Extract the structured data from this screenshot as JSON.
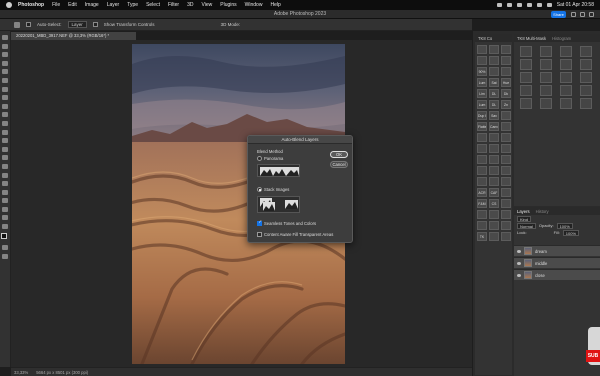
{
  "menubar": {
    "app": "Photoshop",
    "items": [
      "File",
      "Edit",
      "Image",
      "Layer",
      "Type",
      "Select",
      "Filter",
      "3D",
      "View",
      "Plugins",
      "Window",
      "Help"
    ],
    "clock": "Sat 01 Apr  20:58"
  },
  "window": {
    "title": "Adobe Photoshop 2023",
    "share_label": "Share"
  },
  "options": {
    "auto_select": "Auto-Select:",
    "target": "Layer",
    "show_transform": "Show Transform Controls",
    "mode_3d": "3D Mode:"
  },
  "document": {
    "tab": "20220201_MBD_3917.NEF @ 33,3% (RGB/16*) *"
  },
  "status": {
    "zoom": "33,33%",
    "info": "5664 px x 8501 px (300 ppi)"
  },
  "dialog": {
    "title": "Auto-Blend Layers",
    "blend_method_label": "Blend Method",
    "panorama_label": "Panorama",
    "stack_images_label": "Stack Images",
    "selected_method": "stack",
    "seamless_label": "Seamless Tones and Colors",
    "seamless_checked": true,
    "content_aware_label": "Content Aware Fill Transparent Areas",
    "content_aware_checked": false,
    "ok_label": "OK",
    "cancel_label": "Cancel"
  },
  "panels": {
    "tab1": "TK8 Co",
    "tab2": "TK8 Multi-Mask",
    "tab3": "Histogram",
    "buttons": [
      {
        "label": ""
      },
      {
        "label": ""
      },
      {
        "label": ""
      },
      {
        "label": ""
      },
      {
        "label": ""
      },
      {
        "label": ""
      },
      {
        "label": "90%"
      },
      {
        "label": ""
      },
      {
        "label": ""
      },
      {
        "label": "Lum"
      },
      {
        "label": "Sat"
      },
      {
        "label": "Hue"
      },
      {
        "label": "Lim"
      },
      {
        "label": "DL"
      },
      {
        "label": "Dk"
      },
      {
        "label": "Lum"
      },
      {
        "label": "DL"
      },
      {
        "label": "Zn"
      },
      {
        "label": "Dup Img"
      },
      {
        "label": "Sav"
      },
      {
        "label": ""
      },
      {
        "label": "Flatten"
      },
      {
        "label": "Canvas"
      },
      {
        "label": ""
      },
      {
        "label": ""
      },
      {
        "label": ""
      },
      {
        "label": ""
      },
      {
        "label": ""
      },
      {
        "label": ""
      },
      {
        "label": ""
      },
      {
        "label": ""
      },
      {
        "label": ""
      },
      {
        "label": ""
      },
      {
        "label": ""
      },
      {
        "label": ""
      },
      {
        "label": ""
      },
      {
        "label": ""
      },
      {
        "label": ""
      },
      {
        "label": ""
      },
      {
        "label": "ACR"
      },
      {
        "label": "CAF"
      },
      {
        "label": ""
      },
      {
        "label": "F&M"
      },
      {
        "label": "CS"
      },
      {
        "label": ""
      },
      {
        "label": ""
      },
      {
        "label": ""
      },
      {
        "label": ""
      },
      {
        "label": ""
      },
      {
        "label": ""
      },
      {
        "label": ""
      },
      {
        "label": "TK"
      },
      {
        "label": ""
      },
      {
        "label": ""
      }
    ]
  },
  "layers": {
    "tab": "Layers",
    "tab2": "History",
    "kind_label": "Kind",
    "blend_mode": "Normal",
    "opacity_label": "Opacity:",
    "opacity_value": "100%",
    "lock_label": "Lock:",
    "fill_label": "Fill:",
    "fill_value": "100%",
    "items": [
      {
        "name": "dream",
        "selected": true
      },
      {
        "name": "middle",
        "selected": true
      },
      {
        "name": "close",
        "selected": true
      }
    ]
  },
  "overlay": {
    "label": "SUB"
  }
}
